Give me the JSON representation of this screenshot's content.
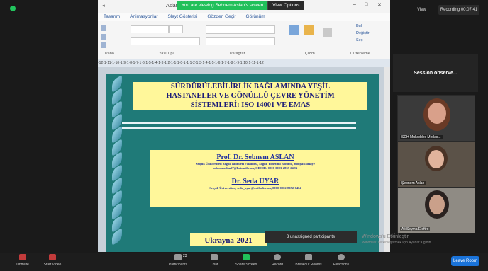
{
  "banner": {
    "viewing_text": "You are viewing Sebnem Aslan's screen",
    "view_options": "View Options"
  },
  "window": {
    "title": "Aslan"
  },
  "ribbon": {
    "tabs": [
      "Tasarım",
      "Animasyonlar",
      "Slayt Gösterisi",
      "Gözden Geçir",
      "Görünüm"
    ],
    "groups": [
      "Pano",
      "Yazı Tipi",
      "Paragraf",
      "Çizim",
      "Düzenleme"
    ],
    "buttons": [
      "Bul",
      "Değiştir",
      "Seç"
    ]
  },
  "ruler": "·12·1·11·1·10·1·9·1·8·1·7·1·6·1·5·1·4·1·3·1·2·1·1·1·0·1·1·1·2·1·3·1·4·1·5·1·6·1·7·1·8·1·9·1·10·1·11·1·12",
  "slide": {
    "title_lines": [
      "SÜRDÜRÜLEBİLİRLİK BAĞLAMINDA YEŞİL",
      "HASTANELER VE GÖNÜLLÜ ÇEVRE YÖNETİM",
      "SİSTEMLERİ: ISO 14001 VE EMAS"
    ],
    "author1": "Prof. Dr. Sebnem ASLAN",
    "author1_aff": "Selçuk Üniversitesi Sağlık Bilimleri Fakültesi, Sağlık Yönetimi Bölümü, Konya/Türkiye",
    "author1_contact": "sebnemaslan27@hotmail.com, ORCID: 0000-0003-2835-242X",
    "author2": "Dr. Seda UYAR",
    "author2_aff": "Selçuk Üniversitesi, seda_uyar@outlook.com, 0000-0002-8052-0464",
    "country": "Ukrayna-2021"
  },
  "unassigned": "3 unassigned participants",
  "top_right": {
    "view": "View",
    "recording": "Recording 00:07:41"
  },
  "session_observe": "Session observe...",
  "participants": [
    {
      "name": "SDH Mukaddes Merlas..."
    },
    {
      "name": "Şebnem Aslan"
    },
    {
      "name": "Ali Seyma Eleftro"
    }
  ],
  "watermark": [
    "Windows'u Etkinleştir",
    "Windows'u etkinleştirmek için Ayarlar'a gidin."
  ],
  "toolbar": {
    "unmute": "Unmute",
    "start_video": "Start Video",
    "participants": "Participants",
    "participants_count": "23",
    "chat": "Chat",
    "share_screen": "Share Screen",
    "record": "Record",
    "breakout_rooms": "Breakout Rooms",
    "reactions": "Reactions",
    "leave": "Leave Room"
  },
  "colors": {
    "accent": "#1a73d9",
    "green": "#21c05a",
    "slide_bg": "#1f7a78",
    "panel": "#fff79a"
  }
}
